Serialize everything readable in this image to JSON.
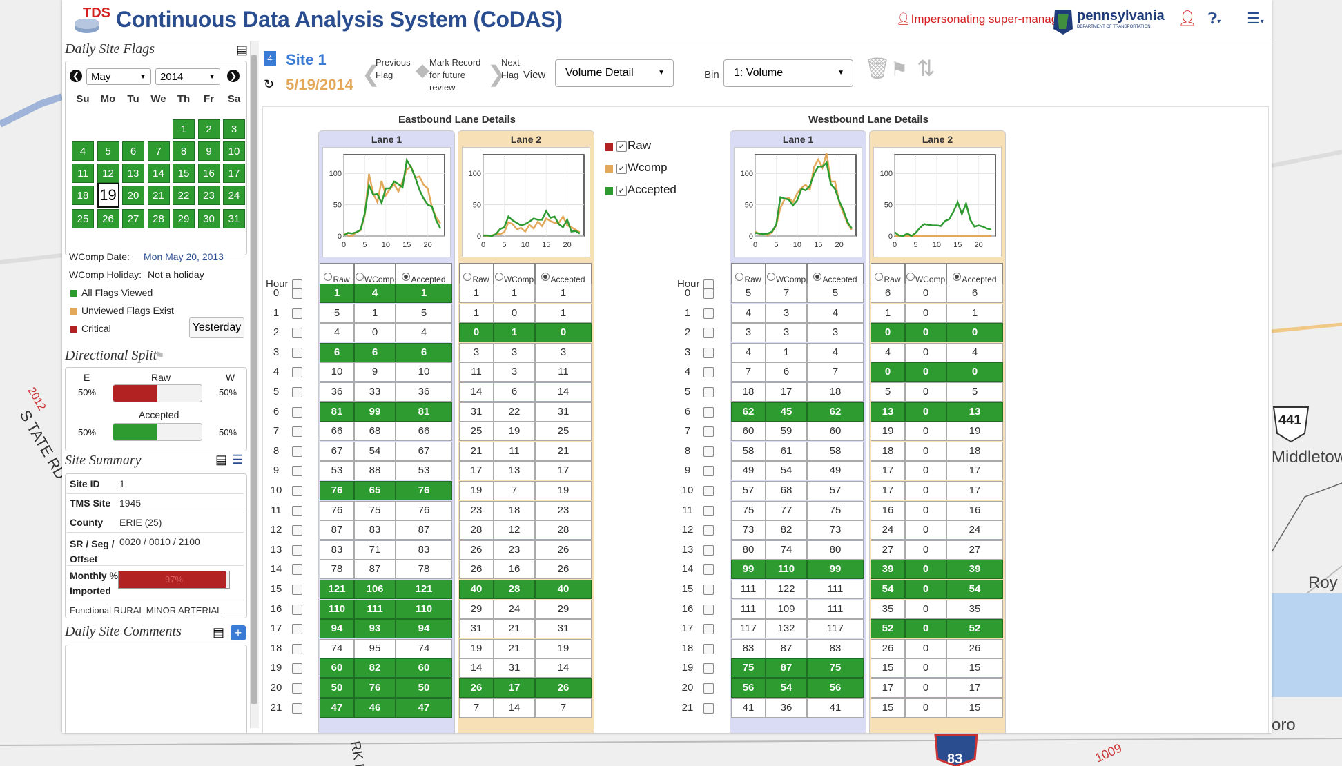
{
  "map": {
    "labels": [
      "2012",
      "S TATE RD",
      "441",
      "Middletown",
      "Roy",
      "oro",
      "83",
      "1009",
      "RK R"
    ]
  },
  "app": {
    "title": "Continuous Data Analysis System (CoDAS)",
    "logo_text": "TDS",
    "impersonating": "Impersonating super-manager",
    "penn_name": "pennsylvania",
    "penn_sub": "DEPARTMENT OF TRANSPORTATION",
    "icons": [
      "user-icon",
      "help-icon",
      "menu-icon"
    ]
  },
  "sidebar": {
    "daily_site_flags": {
      "title": "Daily Site Flags",
      "month": "May",
      "year": "2014",
      "dows": [
        "Su",
        "Mo",
        "Tu",
        "We",
        "Th",
        "Fr",
        "Sa"
      ],
      "weeks": [
        [
          "",
          "",
          "",
          "",
          "1",
          "2",
          "3"
        ],
        [
          "4",
          "5",
          "6",
          "7",
          "8",
          "9",
          "10"
        ],
        [
          "11",
          "12",
          "13",
          "14",
          "15",
          "16",
          "17"
        ],
        [
          "18",
          "19",
          "20",
          "21",
          "22",
          "23",
          "24"
        ],
        [
          "25",
          "26",
          "27",
          "28",
          "29",
          "30",
          "31"
        ]
      ],
      "selected_day": "19",
      "wcomp_date_label": "WComp Date:",
      "wcomp_date": "Mon May 20, 2013",
      "wcomp_holiday_label": "WComp Holiday:",
      "wcomp_holiday": "Not a holiday",
      "legend": [
        {
          "label": "All Flags Viewed",
          "color": "#2e9b31"
        },
        {
          "label": "Unviewed Flags Exist",
          "color": "#e3a85a"
        },
        {
          "label": "Critical",
          "color": "#b22222"
        }
      ],
      "yesterday": "Yesterday"
    },
    "directional_split": {
      "title": "Directional Split",
      "e_label": "E",
      "w_label": "W",
      "raw_label": "Raw",
      "accepted_label": "Accepted",
      "raw_e": "50%",
      "raw_w": "50%",
      "acc_e": "50%",
      "acc_w": "50%",
      "raw_fraction": 0.5,
      "acc_fraction": 0.5,
      "raw_color": "#b22222",
      "acc_color": "#2e9b31"
    },
    "site_summary": {
      "title": "Site Summary",
      "rows": [
        {
          "k": "Site ID",
          "v": "1"
        },
        {
          "k": "TMS Site",
          "v": "1945"
        },
        {
          "k": "County",
          "v": "ERIE (25)"
        },
        {
          "k": "SR / Seg / Offset",
          "v": "0020 / 0010 / 2100"
        },
        {
          "k": "Monthly % Imported",
          "v": "97%"
        }
      ],
      "monthly_imported_fraction": 0.97,
      "partial_row": "Functional RURAL MINOR ARTERIAL"
    },
    "daily_site_comments": {
      "title": "Daily Site Comments"
    }
  },
  "toolbar": {
    "flag_count": "4",
    "site": "Site 1",
    "date": "5/19/2014",
    "prev_flag": [
      "Previous",
      "Flag"
    ],
    "mark_record": [
      "Mark Record",
      "for future",
      "review"
    ],
    "next_flag": [
      "Next",
      "Flag"
    ],
    "view_label": "View",
    "view_value": "Volume Detail",
    "bin_label": "Bin",
    "bin_value": "1: Volume"
  },
  "main": {
    "eb_title": "Eastbound Lane Details",
    "wb_title": "Westbound Lane Details",
    "lane_names": [
      "Lane 1",
      "Lane 2"
    ],
    "hour_label": "Hour",
    "col_headers": [
      "Raw",
      "WComp",
      "Accepted"
    ],
    "legend": [
      {
        "label": "Raw",
        "color": "#b22222"
      },
      {
        "label": "Wcomp",
        "color": "#e3a85a"
      },
      {
        "label": "Accepted",
        "color": "#2e9b31"
      }
    ],
    "hours": [
      "0",
      "1",
      "2",
      "3",
      "4",
      "5",
      "6",
      "7",
      "8",
      "9",
      "10",
      "11",
      "12",
      "13",
      "14",
      "15",
      "16",
      "17",
      "18",
      "19",
      "20",
      "21"
    ],
    "eb_lane1": [
      [
        1,
        4,
        1,
        1
      ],
      [
        5,
        1,
        5,
        0
      ],
      [
        4,
        0,
        4,
        0
      ],
      [
        6,
        6,
        6,
        1
      ],
      [
        10,
        9,
        10,
        0
      ],
      [
        36,
        33,
        36,
        0
      ],
      [
        81,
        99,
        81,
        1
      ],
      [
        66,
        68,
        66,
        0
      ],
      [
        67,
        54,
        67,
        0
      ],
      [
        53,
        88,
        53,
        0
      ],
      [
        76,
        65,
        76,
        1
      ],
      [
        76,
        75,
        76,
        0
      ],
      [
        87,
        83,
        87,
        0
      ],
      [
        83,
        71,
        83,
        0
      ],
      [
        78,
        87,
        78,
        0
      ],
      [
        121,
        106,
        121,
        1
      ],
      [
        110,
        111,
        110,
        1
      ],
      [
        94,
        93,
        94,
        1
      ],
      [
        74,
        95,
        74,
        0
      ],
      [
        60,
        82,
        60,
        1
      ],
      [
        50,
        76,
        50,
        1
      ],
      [
        47,
        46,
        47,
        1
      ]
    ],
    "eb_lane2": [
      [
        1,
        1,
        1,
        0
      ],
      [
        1,
        0,
        1,
        0
      ],
      [
        0,
        1,
        0,
        1
      ],
      [
        3,
        3,
        3,
        0
      ],
      [
        11,
        3,
        11,
        0
      ],
      [
        14,
        6,
        14,
        0
      ],
      [
        31,
        22,
        31,
        0
      ],
      [
        25,
        19,
        25,
        0
      ],
      [
        21,
        11,
        21,
        0
      ],
      [
        17,
        13,
        17,
        0
      ],
      [
        19,
        7,
        19,
        0
      ],
      [
        23,
        18,
        23,
        0
      ],
      [
        28,
        12,
        28,
        0
      ],
      [
        26,
        23,
        26,
        0
      ],
      [
        26,
        16,
        26,
        0
      ],
      [
        40,
        28,
        40,
        1
      ],
      [
        29,
        24,
        29,
        0
      ],
      [
        31,
        21,
        31,
        0
      ],
      [
        19,
        21,
        19,
        0
      ],
      [
        14,
        31,
        14,
        0
      ],
      [
        26,
        17,
        26,
        1
      ],
      [
        7,
        14,
        7,
        0
      ]
    ],
    "wb_lane1": [
      [
        5,
        7,
        5,
        0
      ],
      [
        4,
        3,
        4,
        0
      ],
      [
        3,
        3,
        3,
        0
      ],
      [
        4,
        1,
        4,
        0
      ],
      [
        7,
        6,
        7,
        0
      ],
      [
        18,
        17,
        18,
        0
      ],
      [
        62,
        45,
        62,
        1
      ],
      [
        60,
        59,
        60,
        0
      ],
      [
        58,
        61,
        58,
        0
      ],
      [
        49,
        54,
        49,
        0
      ],
      [
        57,
        68,
        57,
        0
      ],
      [
        75,
        77,
        75,
        0
      ],
      [
        73,
        82,
        73,
        0
      ],
      [
        80,
        74,
        80,
        0
      ],
      [
        99,
        110,
        99,
        1
      ],
      [
        111,
        122,
        111,
        0
      ],
      [
        111,
        109,
        111,
        0
      ],
      [
        117,
        132,
        117,
        0
      ],
      [
        83,
        87,
        83,
        0
      ],
      [
        75,
        87,
        75,
        1
      ],
      [
        56,
        54,
        56,
        1
      ],
      [
        41,
        36,
        41,
        0
      ]
    ],
    "wb_lane2": [
      [
        6,
        0,
        6,
        0
      ],
      [
        1,
        0,
        1,
        0
      ],
      [
        0,
        0,
        0,
        1
      ],
      [
        4,
        0,
        4,
        0
      ],
      [
        0,
        0,
        0,
        1
      ],
      [
        5,
        0,
        5,
        0
      ],
      [
        13,
        0,
        13,
        1
      ],
      [
        19,
        0,
        19,
        0
      ],
      [
        18,
        0,
        18,
        0
      ],
      [
        17,
        0,
        17,
        0
      ],
      [
        17,
        0,
        17,
        0
      ],
      [
        16,
        0,
        16,
        0
      ],
      [
        24,
        0,
        24,
        0
      ],
      [
        27,
        0,
        27,
        0
      ],
      [
        39,
        0,
        39,
        1
      ],
      [
        54,
        0,
        54,
        1
      ],
      [
        35,
        0,
        35,
        0
      ],
      [
        52,
        0,
        52,
        1
      ],
      [
        26,
        0,
        26,
        0
      ],
      [
        15,
        0,
        15,
        0
      ],
      [
        17,
        0,
        17,
        0
      ],
      [
        15,
        0,
        15,
        0
      ]
    ],
    "chart_ticks_y": [
      "0",
      "50",
      "100"
    ],
    "chart_ticks_x": [
      "0",
      "5",
      "10",
      "15",
      "20"
    ]
  },
  "chart_data": [
    {
      "type": "line",
      "title": "Lane 1",
      "x": [
        0,
        1,
        2,
        3,
        4,
        5,
        6,
        7,
        8,
        9,
        10,
        11,
        12,
        13,
        14,
        15,
        16,
        17,
        18,
        19,
        20,
        21,
        22,
        23
      ],
      "series": [
        {
          "name": "Wcomp",
          "values": [
            4,
            1,
            0,
            6,
            9,
            33,
            99,
            68,
            54,
            88,
            65,
            75,
            83,
            71,
            87,
            106,
            111,
            93,
            95,
            82,
            76,
            46,
            30,
            20
          ]
        },
        {
          "name": "Accepted",
          "values": [
            1,
            5,
            4,
            6,
            10,
            36,
            81,
            66,
            67,
            53,
            76,
            76,
            87,
            83,
            78,
            121,
            110,
            94,
            74,
            60,
            50,
            47,
            25,
            12
          ]
        }
      ],
      "ylim": [
        0,
        130
      ],
      "xlim": [
        0,
        24
      ]
    },
    {
      "type": "line",
      "title": "Lane 2",
      "x": [
        0,
        1,
        2,
        3,
        4,
        5,
        6,
        7,
        8,
        9,
        10,
        11,
        12,
        13,
        14,
        15,
        16,
        17,
        18,
        19,
        20,
        21,
        22,
        23
      ],
      "series": [
        {
          "name": "Wcomp",
          "values": [
            1,
            0,
            1,
            3,
            3,
            6,
            22,
            19,
            11,
            13,
            7,
            18,
            12,
            23,
            16,
            28,
            24,
            21,
            21,
            31,
            17,
            14,
            10,
            6
          ]
        },
        {
          "name": "Accepted",
          "values": [
            1,
            1,
            0,
            3,
            11,
            14,
            31,
            25,
            21,
            17,
            19,
            23,
            28,
            26,
            26,
            40,
            29,
            31,
            19,
            14,
            26,
            7,
            8,
            4
          ]
        }
      ],
      "ylim": [
        0,
        130
      ],
      "xlim": [
        0,
        24
      ]
    },
    {
      "type": "line",
      "title": "Lane 1",
      "x": [
        0,
        1,
        2,
        3,
        4,
        5,
        6,
        7,
        8,
        9,
        10,
        11,
        12,
        13,
        14,
        15,
        16,
        17,
        18,
        19,
        20,
        21,
        22,
        23
      ],
      "series": [
        {
          "name": "Wcomp",
          "values": [
            7,
            3,
            3,
            1,
            6,
            17,
            45,
            59,
            61,
            54,
            68,
            77,
            82,
            74,
            110,
            122,
            109,
            132,
            87,
            87,
            54,
            36,
            20,
            10
          ]
        },
        {
          "name": "Accepted",
          "values": [
            5,
            4,
            3,
            4,
            7,
            18,
            62,
            60,
            58,
            49,
            57,
            75,
            73,
            80,
            99,
            111,
            111,
            117,
            83,
            75,
            56,
            41,
            22,
            12
          ]
        }
      ],
      "ylim": [
        0,
        130
      ],
      "xlim": [
        0,
        24
      ]
    },
    {
      "type": "line",
      "title": "Lane 2",
      "x": [
        0,
        1,
        2,
        3,
        4,
        5,
        6,
        7,
        8,
        9,
        10,
        11,
        12,
        13,
        14,
        15,
        16,
        17,
        18,
        19,
        20,
        21,
        22,
        23
      ],
      "series": [
        {
          "name": "Wcomp",
          "values": [
            0,
            0,
            0,
            0,
            0,
            0,
            0,
            0,
            0,
            0,
            0,
            0,
            0,
            0,
            0,
            0,
            0,
            0,
            0,
            0,
            0,
            0,
            0,
            0
          ]
        },
        {
          "name": "Accepted",
          "values": [
            6,
            1,
            0,
            4,
            0,
            5,
            13,
            19,
            18,
            17,
            17,
            16,
            24,
            27,
            39,
            54,
            35,
            52,
            26,
            15,
            17,
            15,
            12,
            10
          ]
        }
      ],
      "ylim": [
        0,
        130
      ],
      "xlim": [
        0,
        24
      ]
    }
  ]
}
